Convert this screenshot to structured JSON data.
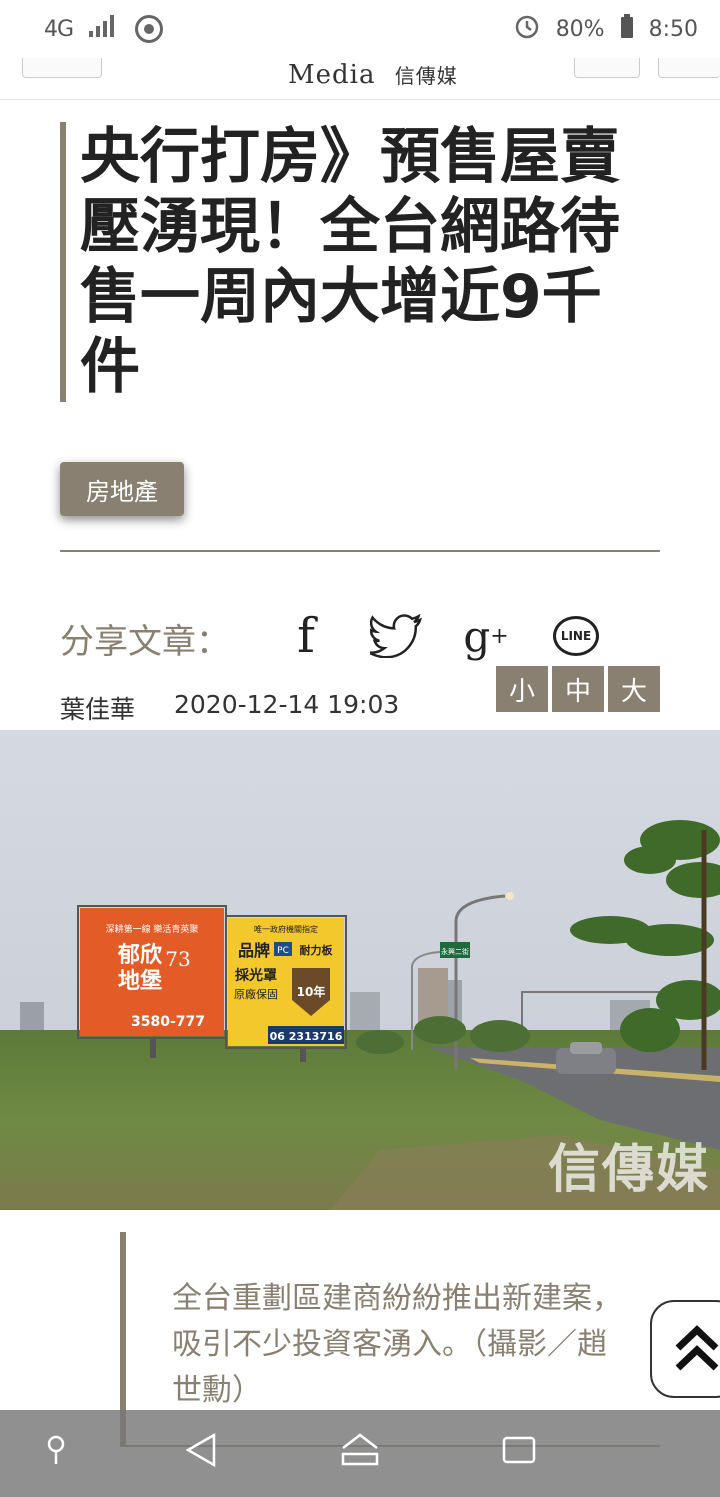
{
  "status_bar": {
    "network": "4G",
    "battery": "80%",
    "time": "8:50"
  },
  "header": {
    "logo_text": "Media",
    "logo_cn": "信傳媒"
  },
  "article": {
    "title": "央行打房》預售屋賣壓湧現！全台網路待售一周內大增近9千件",
    "category": "房地產",
    "share_label": "分享文章：",
    "share_icons": [
      "facebook-icon",
      "twitter-icon",
      "google-plus-icon",
      "line-icon"
    ],
    "line_label": "LINE",
    "font_sizes": [
      "小",
      "中",
      "大"
    ],
    "author": "葉佳華",
    "date": "2020-12-14 19:03"
  },
  "photo": {
    "billboard_left": {
      "lines": [
        "深耕第一線 樂活青英聚",
        "郁欣",
        "73",
        "地堡",
        "3580-777"
      ]
    },
    "billboard_right": {
      "lines": [
        "唯一政府機關指定",
        "品牌",
        "PC",
        "耐力板",
        "採光罩",
        "原廠保固",
        "10年",
        "06 2313716"
      ]
    },
    "road_sign": "永興二街",
    "watermark": "信傳媒"
  },
  "caption": "全台重劃區建商紛紛推出新建案，吸引不少投資客湧入。（攝影／趙世勳）",
  "colors": {
    "accent": "#8a8072",
    "text": "#222222"
  }
}
